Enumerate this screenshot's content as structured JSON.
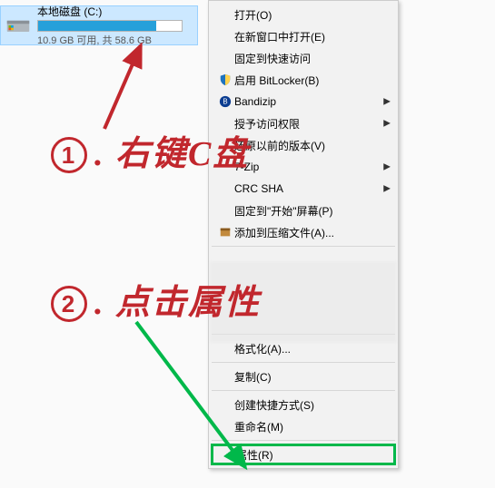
{
  "drive": {
    "name": "本地磁盘 (C:)",
    "subtitle": "10.9 GB 可用, 共 58.6 GB"
  },
  "menu": {
    "open": "打开(O)",
    "open_new_window": "在新窗口中打开(E)",
    "pin_quick_access": "固定到快速访问",
    "bitlocker": "启用 BitLocker(B)",
    "bandizip": "Bandizip",
    "grant_access": "授予访问权限",
    "restore_prev": "还原以前的版本(V)",
    "seven_zip": "7-Zip",
    "crc_sha": "CRC SHA",
    "pin_start": "固定到\"开始\"屏幕(P)",
    "add_to_archive": "添加到压缩文件(A)...",
    "format": "格式化(A)...",
    "copy": "复制(C)",
    "create_shortcut": "创建快捷方式(S)",
    "rename": "重命名(M)",
    "properties": "属性(R)"
  },
  "annotations": {
    "step1_num": "1",
    "step1_text": ". 右键C盘",
    "step2_num": "2",
    "step2_text": ". 点击属性"
  }
}
